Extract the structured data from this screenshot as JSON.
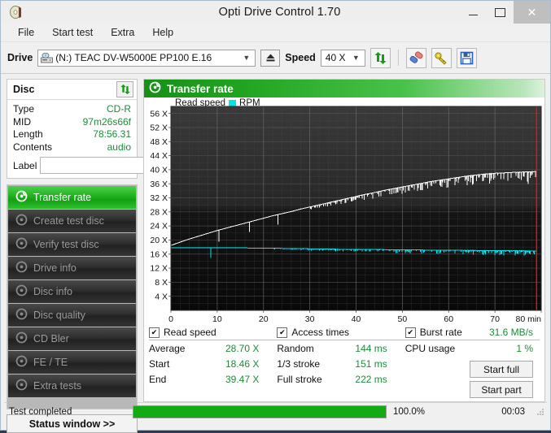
{
  "window": {
    "title": "Opti Drive Control 1.70",
    "icon": "disc-icon",
    "minimize": "–",
    "maximize": "□",
    "close": "✕"
  },
  "menu": {
    "items": [
      {
        "label": "File"
      },
      {
        "label": "Start test"
      },
      {
        "label": "Extra"
      },
      {
        "label": "Help"
      }
    ]
  },
  "toolbar": {
    "drive_label": "Drive",
    "drive_value": "(N:)  TEAC DV-W5000E PP100 E.16",
    "eject_icon": "eject-icon",
    "speed_label": "Speed",
    "speed_value": "40 X",
    "refresh_icon": "refresh-icon",
    "eraser_icon": "eraser-icon",
    "key_icon": "key-icon",
    "save_icon": "save-icon"
  },
  "disc": {
    "title": "Disc",
    "refresh_icon": "refresh-icon",
    "rows": [
      {
        "key": "Type",
        "value": "CD-R"
      },
      {
        "key": "MID",
        "value": "97m26s66f"
      },
      {
        "key": "Length",
        "value": "78:56.31"
      },
      {
        "key": "Contents",
        "value": "audio"
      }
    ],
    "label_key": "Label",
    "label_value": "",
    "label_button_icon": "disc-icon"
  },
  "sidebar": {
    "items": [
      {
        "label": "Transfer rate",
        "icon": "disc-icon",
        "active": true
      },
      {
        "label": "Create test disc",
        "icon": "disc-icon",
        "active": false
      },
      {
        "label": "Verify test disc",
        "icon": "disc-icon",
        "active": false
      },
      {
        "label": "Drive info",
        "icon": "disc-icon",
        "active": false
      },
      {
        "label": "Disc info",
        "icon": "disc-icon",
        "active": false
      },
      {
        "label": "Disc quality",
        "icon": "disc-icon",
        "active": false
      },
      {
        "label": "CD Bler",
        "icon": "disc-icon",
        "active": false
      },
      {
        "label": "FE / TE",
        "icon": "disc-icon",
        "active": false
      },
      {
        "label": "Extra tests",
        "icon": "disc-icon",
        "active": false
      }
    ],
    "status_window": "Status window >>"
  },
  "panel": {
    "title": "Transfer rate",
    "icon": "disc-icon"
  },
  "results": {
    "read_speed": {
      "title": "Read speed",
      "checked": true,
      "rows": [
        {
          "key": "Average",
          "value": "28.70 X"
        },
        {
          "key": "Start",
          "value": "18.46 X"
        },
        {
          "key": "End",
          "value": "39.47 X"
        }
      ]
    },
    "access_times": {
      "title": "Access times",
      "checked": true,
      "rows": [
        {
          "key": "Random",
          "value": "144 ms"
        },
        {
          "key": "1/3 stroke",
          "value": "151 ms"
        },
        {
          "key": "Full stroke",
          "value": "222 ms"
        }
      ]
    },
    "misc": {
      "burst_title": "Burst rate",
      "burst_checked": true,
      "burst_value": "31.6 MB/s",
      "cpu_key": "CPU usage",
      "cpu_value": "1 %",
      "start_full": "Start full",
      "start_part": "Start part"
    }
  },
  "statusbar": {
    "message": "Test completed",
    "percent_label": "100.0%",
    "percent_value": 100,
    "elapsed": "00:03"
  },
  "colors": {
    "accent_green": "#16a816",
    "value_green": "#1e8b3a",
    "read_speed_line": "#ffffff",
    "rpm_line": "#00e5ee",
    "end_marker": "#ee1111",
    "plot_bg": "#1c1c1c"
  },
  "chart_data": {
    "type": "line",
    "title": "Transfer rate",
    "xlabel": "min",
    "ylabel": "X",
    "xlim": [
      0,
      80
    ],
    "ylim": [
      0,
      58
    ],
    "grid": true,
    "legend_position": "top-left",
    "xticks": [
      0,
      10,
      20,
      30,
      40,
      50,
      60,
      70,
      80
    ],
    "xtick_labels": [
      "0",
      "10",
      "20",
      "30",
      "40",
      "50",
      "60",
      "70",
      "80 min"
    ],
    "yticks": [
      4,
      8,
      12,
      16,
      20,
      24,
      28,
      32,
      36,
      40,
      44,
      48,
      52,
      56
    ],
    "ytick_labels": [
      "4 X",
      "8 X",
      "12 X",
      "16 X",
      "20 X",
      "24 X",
      "28 X",
      "32 X",
      "36 X",
      "40 X",
      "44 X",
      "48 X",
      "52 X",
      "56 X"
    ],
    "end_marker_x": 79.0,
    "series": [
      {
        "name": "Read speed",
        "color": "#ffffff",
        "x": [
          0,
          2,
          4,
          6,
          8,
          10,
          12,
          14,
          16,
          18,
          20,
          22,
          24,
          26,
          28,
          30,
          32,
          34,
          36,
          38,
          40,
          42,
          44,
          46,
          48,
          50,
          52,
          54,
          56,
          58,
          60,
          62,
          64,
          66,
          68,
          70,
          72,
          74,
          76,
          78,
          79
        ],
        "values": [
          18.46,
          19.4,
          20.3,
          21.1,
          21.9,
          22.7,
          23.4,
          24.1,
          24.8,
          25.5,
          26.2,
          26.9,
          27.5,
          28.1,
          28.8,
          29.4,
          30.0,
          30.6,
          31.2,
          31.8,
          32.4,
          33.0,
          33.5,
          34.1,
          34.6,
          35.1,
          35.6,
          36.1,
          36.6,
          37.0,
          37.4,
          37.8,
          38.2,
          38.5,
          38.8,
          39.0,
          39.1,
          39.25,
          39.35,
          39.44,
          39.47
        ],
        "noise_start_x": 30,
        "noise_amplitude": 2.6,
        "note": "CAV ramp from 18.46 X at disc start to 39.47 X at disc end; increasing downward spike noise after ~30 min"
      },
      {
        "name": "RPM",
        "color": "#00e5ee",
        "x": [
          0,
          5,
          10,
          15,
          20,
          25,
          30,
          35,
          40,
          45,
          50,
          55,
          60,
          65,
          70,
          75,
          79
        ],
        "values": [
          17.8,
          17.8,
          17.8,
          17.75,
          17.7,
          17.6,
          17.5,
          17.4,
          17.35,
          17.3,
          17.2,
          17.15,
          17.1,
          17.05,
          17.0,
          16.95,
          16.9
        ],
        "noise_start_x": 22,
        "noise_amplitude": 1.1,
        "note": "Constant angular velocity trace, nearly flat near 17-18 X with increasing jitter"
      }
    ]
  }
}
